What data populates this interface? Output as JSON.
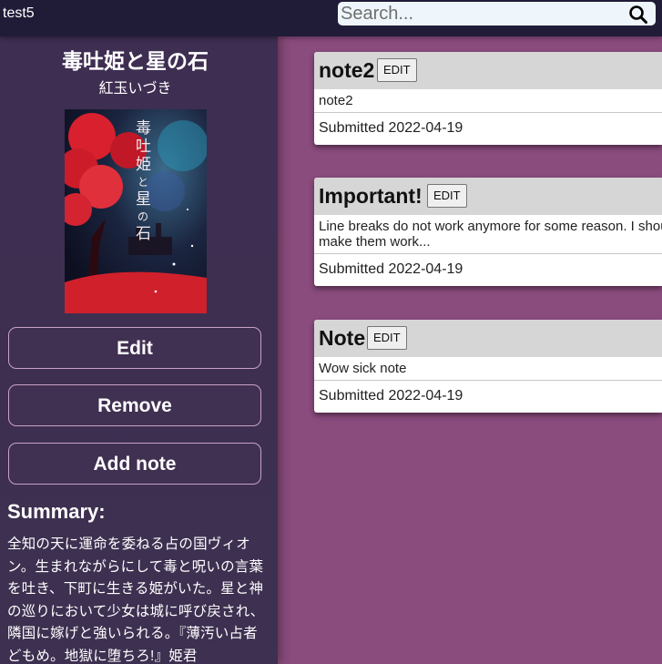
{
  "app": {
    "title": "test5"
  },
  "search": {
    "placeholder": "Search..."
  },
  "book": {
    "title": "毒吐姫と星の石",
    "author": "紅玉いづき",
    "cover": {
      "title_text": "毒吐姫と星の石",
      "author_text": "紅玉いづき"
    }
  },
  "sidebar": {
    "buttons": {
      "edit": "Edit",
      "remove": "Remove",
      "add_note": "Add note"
    },
    "summary_heading": "Summary:",
    "summary_text": "全知の天に運命を委ねる占の国ヴィオン。生まれながらにして毒と呪いの言葉を吐き、下町に生きる姫がいた。星と神の巡りにおいて少女は城に呼び戻され、隣国に嫁げと強いられる。『薄汚い占者どもめ。地獄に堕ちろ!』姫君"
  },
  "notes": [
    {
      "title": "note2",
      "edit_label": "EDIT",
      "body": "note2",
      "submitted": "Submitted 2022-04-19"
    },
    {
      "title": "Important!",
      "edit_label": "EDIT",
      "body": "Line breaks do not work anymore for some reason. I should make them work...",
      "submitted": "Submitted 2022-04-19"
    },
    {
      "title": "Note",
      "edit_label": "EDIT",
      "body": "Wow sick note",
      "submitted": "Submitted 2022-04-19"
    }
  ],
  "colors": {
    "topbar": "#201c38",
    "sidebar": "#3e2e52",
    "background": "#8a4b7d",
    "note_header": "#d6d6d6",
    "button_border": "#c9a2c4"
  },
  "icons": {
    "search": "search-icon"
  }
}
